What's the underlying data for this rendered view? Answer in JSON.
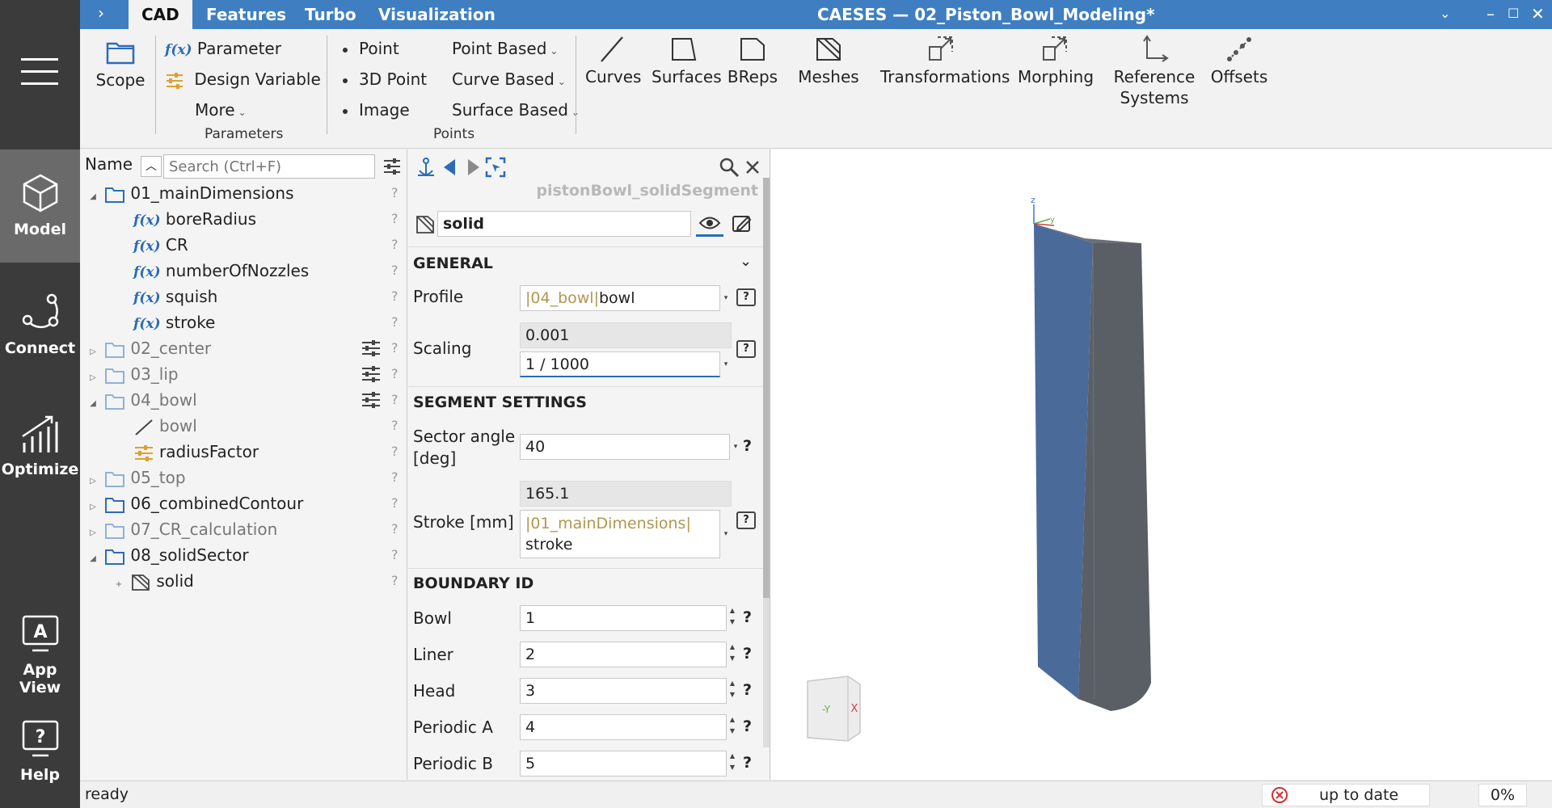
{
  "sidebar": {
    "items": [
      {
        "label": "Model"
      },
      {
        "label": "Connect"
      },
      {
        "label": "Optimize"
      },
      {
        "label": "App View"
      },
      {
        "label": "Help"
      }
    ]
  },
  "titlebar": {
    "tabs": [
      "CAD",
      "Features",
      "Turbo",
      "Visualization"
    ],
    "title": "CAESES — 02_Piston_Bowl_Modeling*"
  },
  "ribbon": {
    "scope": "Scope",
    "parameter": "Parameter",
    "fx_symbol": "f(x)",
    "design_variable": "Design Variable",
    "more": "More",
    "group_parameters": "Parameters",
    "point": "Point",
    "point3d": "3D Point",
    "image": "Image",
    "point_based": "Point Based",
    "curve_based": "Curve Based",
    "surface_based": "Surface Based",
    "group_points": "Points",
    "curves": "Curves",
    "surfaces": "Surfaces",
    "breps": "BReps",
    "meshes": "Meshes",
    "transformations": "Transformations",
    "morphing": "Morphing",
    "reference_systems": "Reference Systems",
    "offsets": "Offsets"
  },
  "tree": {
    "column_name": "Name",
    "search_placeholder": "Search (Ctrl+F)",
    "nodes": [
      {
        "label": "01_mainDimensions"
      },
      {
        "label": "boreRadius"
      },
      {
        "label": "CR"
      },
      {
        "label": "numberOfNozzles"
      },
      {
        "label": "squish"
      },
      {
        "label": "stroke"
      },
      {
        "label": "02_center"
      },
      {
        "label": "03_lip"
      },
      {
        "label": "04_bowl"
      },
      {
        "label": "bowl"
      },
      {
        "label": "radiusFactor"
      },
      {
        "label": "05_top"
      },
      {
        "label": "06_combinedContour"
      },
      {
        "label": "07_CR_calculation"
      },
      {
        "label": "08_solidSector"
      },
      {
        "label": "solid"
      }
    ],
    "q": "?"
  },
  "props": {
    "object_name": "pistonBowl_solidSegment",
    "object_label": "solid",
    "general": "GENERAL",
    "profile_label": "Profile",
    "profile_ref": "|04_bowl|",
    "profile_value": "bowl",
    "scaling_label": "Scaling",
    "scaling_value": "0.001",
    "scaling_expr": "1 / 1000",
    "segment_settings": "SEGMENT SETTINGS",
    "sector_label": "Sector angle [deg]",
    "sector_value": "40",
    "stroke_label": "Stroke [mm]",
    "stroke_value": "165.1",
    "stroke_ref": "|01_mainDimensions|",
    "stroke_expr": "stroke",
    "boundary_id": "BOUNDARY ID",
    "boundaries": [
      {
        "label": "Bowl",
        "value": "1"
      },
      {
        "label": "Liner",
        "value": "2"
      },
      {
        "label": "Head",
        "value": "3"
      },
      {
        "label": "Periodic A",
        "value": "4"
      },
      {
        "label": "Periodic B",
        "value": "5"
      }
    ],
    "q": "?",
    "help": "?"
  },
  "viewport": {
    "axis_z": "z",
    "axis_y": "y",
    "cube_y": "-Y",
    "cube_x": "X"
  },
  "status": {
    "text": "ready",
    "state": "up to date",
    "progress": "0%"
  },
  "colors": {
    "accent": "#3f7fc1",
    "sidebar": "#3b3b3b",
    "solid_face": "#4a6a9a",
    "solid_side": "#5a5f66"
  }
}
